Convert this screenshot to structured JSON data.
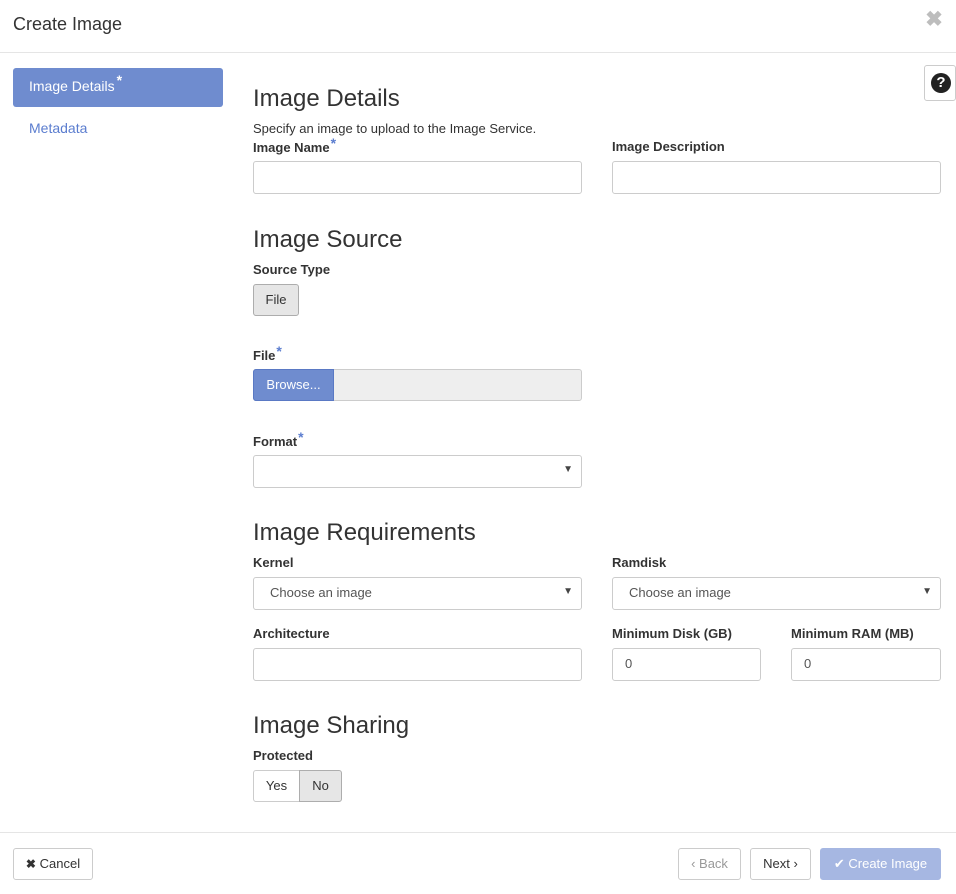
{
  "dialog": {
    "title": "Create Image",
    "close_glyph": "✖"
  },
  "sidebar": {
    "items": [
      {
        "label": "Image Details",
        "required_mark": "*",
        "active": true
      },
      {
        "label": "Metadata",
        "active": false
      }
    ]
  },
  "help": {
    "glyph": "?"
  },
  "details": {
    "heading": "Image Details",
    "hint": "Specify an image to upload to the Image Service.",
    "name_label": "Image Name",
    "name_value": "",
    "description_label": "Image Description",
    "description_value": ""
  },
  "source": {
    "heading": "Image Source",
    "type_label": "Source Type",
    "type_option": "File",
    "file_label": "File",
    "browse_label": "Browse...",
    "file_value": "",
    "format_label": "Format",
    "format_value": ""
  },
  "requirements": {
    "heading": "Image Requirements",
    "kernel_label": "Kernel",
    "kernel_value": "Choose an image",
    "ramdisk_label": "Ramdisk",
    "ramdisk_value": "Choose an image",
    "architecture_label": "Architecture",
    "architecture_value": "",
    "min_disk_label": "Minimum Disk (GB)",
    "min_disk_value": "0",
    "min_ram_label": "Minimum RAM (MB)",
    "min_ram_value": "0"
  },
  "sharing": {
    "heading": "Image Sharing",
    "protected_label": "Protected",
    "yes_label": "Yes",
    "no_label": "No",
    "selected": "No"
  },
  "required_mark": "*",
  "footer": {
    "cancel_label": "Cancel",
    "back_label": "Back",
    "next_label": "Next",
    "create_label": "Create Image"
  },
  "colors": {
    "accent": "#6f8ccf",
    "link": "#5b7dcf",
    "primary_disabled": "#a6b7e2"
  }
}
